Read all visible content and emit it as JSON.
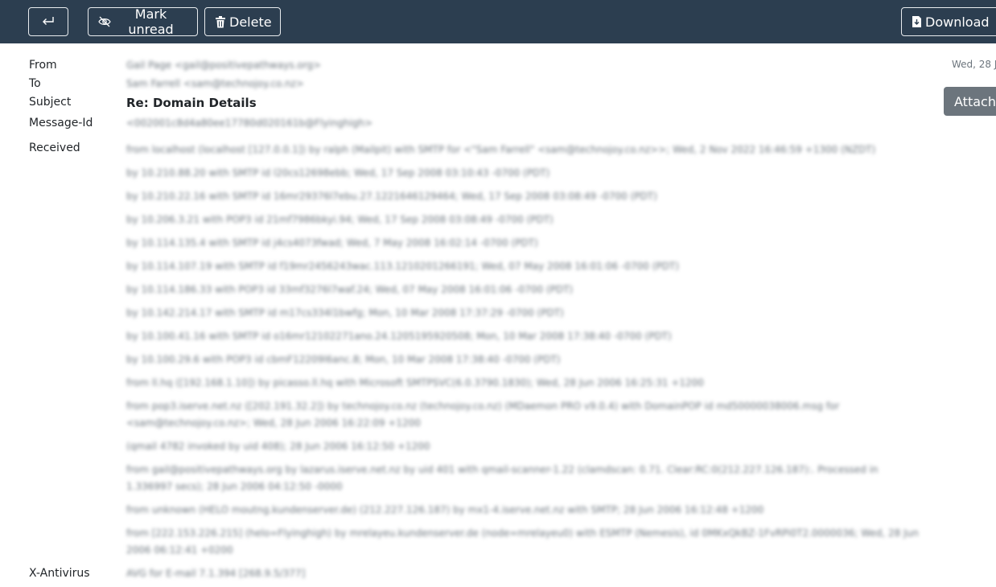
{
  "toolbar": {
    "mark_unread_label": "Mark unread",
    "delete_label": "Delete",
    "download_label": "Download"
  },
  "message": {
    "labels": {
      "from": "From",
      "to": "To",
      "subject": "Subject",
      "message_id": "Message-Id",
      "received": "Received",
      "x_antivirus": "X-Antivirus"
    },
    "from_value": "Gail Page <gail@positivepathways.org>",
    "to_value": "Sam Farrell <sam@technojoy.co.nz>",
    "subject_value": "Re: Domain Details",
    "message_id_value": "<002001c8d4a80ee17780d020161b@Flyinghigh>",
    "date": "Wed, 28 J",
    "attachments_label": "Attachm",
    "received_lines": [
      "from localhost (localhost [127.0.0.1]) by ralph (Mailpit) with SMTP for <\"Sam Farrell\" <sam@technojoy.co.nz>>; Wed, 2 Nov 2022 16:46:59 +1300 (NZDT)",
      "by 10.210.88.20 with SMTP id l20cs12698ebb; Wed, 17 Sep 2008 03:10:43 -0700 (PDT)",
      "by 10.210.22.16 with SMTP id 16mr29376l7ebu.27.1221646129464; Wed, 17 Sep 2008 03:08:49 -0700 (PDT)",
      "by 10.206.3.21 with POP3 id 21mf7986bkyi.94; Wed, 17 Sep 2008 03:08:49 -0700 (PDT)",
      "by 10.114.135.4 with SMTP id j4cs4073fwad; Wed, 7 May 2008 16:02:14 -0700 (PDT)",
      "by 10.114.107.19 with SMTP id f19mr2456243wac.113.1210201266191; Wed, 07 May 2008 16:01:06 -0700 (PDT)",
      "by 10.114.186.33 with POP3 id 33mf3276l7waf.24; Wed, 07 May 2008 16:01:06 -0700 (PDT)",
      "by 10.142.214.17 with SMTP id m17cs334l1bwfg; Mon, 10 Mar 2008 17:37:29 -0700 (PDT)",
      "by 10.100.41.16 with SMTP id o16mr12102271ano.24.1205195920508; Mon, 10 Mar 2008 17:38:40 -0700 (PDT)",
      "by 10.100.29.6 with POP3 id cbmF12209l6anc.8; Mon, 10 Mar 2008 17:38:40 -0700 (PDT)",
      "from ll.hq ([192.168.1.10]) by picasso.ll.hq with Microsoft SMTPSVC(6.0.3790.1830); Wed, 28 Jun 2006 16:25:31 +1200",
      "from pop3.iserve.net.nz ([202.191.32.2]) by technojoy.co.nz (technojoy.co.nz) (MDaemon PRO v9.0.4) with DomainPOP id md50000038006.msg for <sam@technojoy.co.nz>; Wed, 28 Jun 2006 16:22:09 +1200",
      "(qmail 4782 invoked by uid 408); 28 Jun 2006 16:12:50 +1200",
      "from gail@positivepathways.org by lazarus.iserve.net.nz by uid 401 with qmail-scanner-1.22 (clamdscan: 0.71. Clear:RC:0(212.227.126.187):. Processed in 1.336997 secs); 28 Jun 2006 04:12:50 -0000",
      "from unknown (HELO moutng.kundenserver.de) (212.227.126.187) by mx1-4.iserve.net.nz with SMTP; 28 Jun 2006 16:12:48 +1200",
      "from [222.153.226.215] (helo=Flyinghigh) by mrelayeu.kundenserver.de (node=mrelayeu0) with ESMTP (Nemesis), id 0MKxQkBZ-1FvRPi0T2.0000036; Wed, 28 Jun 2006 06:12:41 +0200"
    ],
    "x_antivirus_value": "AVG for E-mail 7.1.394 [268.9.5/377]"
  }
}
